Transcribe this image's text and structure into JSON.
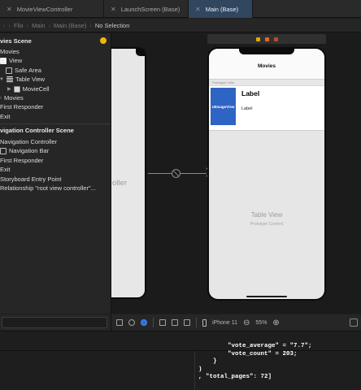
{
  "tabs": [
    {
      "label": "MovieViewController",
      "active": false
    },
    {
      "label": "LaunchScreen (Base)",
      "active": false
    },
    {
      "label": "Main (Base)",
      "active": true
    }
  ],
  "jumpbar": {
    "items": [
      "Flix",
      "Main",
      "Main (Base)"
    ],
    "selection": "No Selection"
  },
  "outline": {
    "movies_scene": "vies Scene",
    "movies_controller": "Movies",
    "view": "View",
    "safe_area": "Safe Area",
    "table_view": "Table View",
    "movie_cell": "MovieCell",
    "movies_item": "Movies",
    "first_responder": "First Responder",
    "exit": "Exit",
    "nav_scene": "vigation Controller Scene",
    "nav_controller": "Navigation Controller",
    "nav_bar": "Navigation Bar",
    "nav_first_responder": "First Responder",
    "nav_exit": "Exit",
    "storyboard_entry": "Storyboard Entry Point",
    "relationship": "Relationship \"root view controller\"..."
  },
  "canvas": {
    "left_phone_label": "oller",
    "nav_title": "Movies",
    "prototype_cells_header": "Prototype Cells",
    "cell_image_label": "UIImageView",
    "cell_title": "Label",
    "cell_subtitle": "Label",
    "table_view_title": "Table View",
    "table_view_subtitle": "Prototype Content"
  },
  "device_bar": {
    "device": "iPhone 11",
    "zoom": "55%",
    "zoom_out": "⊖",
    "zoom_in": "⊕"
  },
  "console": {
    "lines": [
      "        \"vote_average\" = \"7.7\";",
      "        \"vote_count\" = 203;",
      "    }",
      ")",
      ", \"total_pages\": 72]"
    ]
  },
  "colors": {
    "accent": "#31465f",
    "selection_blue": "#2e64c4",
    "warning_yellow": "#f2b800"
  }
}
